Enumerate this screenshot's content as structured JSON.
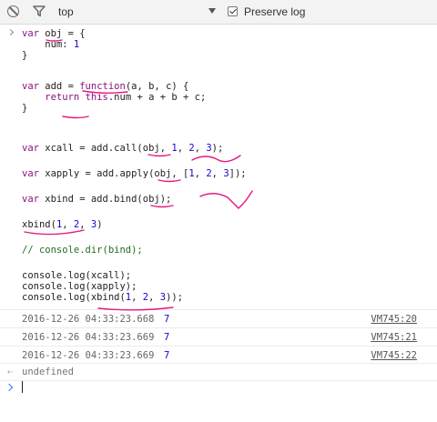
{
  "toolbar": {
    "context": "top",
    "preserve_log_label": "Preserve log",
    "preserve_log_checked": true
  },
  "code_lines": [
    {
      "id": "l1",
      "text": "var obj = {"
    },
    {
      "id": "l2",
      "text": "    num: 1"
    },
    {
      "id": "l3",
      "text": "}"
    },
    {
      "id": "l4",
      "text": ""
    },
    {
      "id": "l5",
      "text": "var add = function(a, b, c) {"
    },
    {
      "id": "l6",
      "text": "    return this.num + a + b + c;"
    },
    {
      "id": "l7",
      "text": "}"
    },
    {
      "id": "l8",
      "text": ""
    },
    {
      "id": "l9",
      "text": ""
    },
    {
      "id": "l10",
      "text": "var xcall = add.call(obj, 1, 2, 3);"
    },
    {
      "id": "l11",
      "text": ""
    },
    {
      "id": "l12",
      "text": "var xapply = add.apply(obj, [1, 2, 3]);"
    },
    {
      "id": "l13",
      "text": ""
    },
    {
      "id": "l14",
      "text": "var xbind = add.bind(obj);"
    },
    {
      "id": "l15",
      "text": ""
    },
    {
      "id": "l16",
      "text": "xbind(1, 2, 3)"
    },
    {
      "id": "l17",
      "text": ""
    },
    {
      "id": "l18",
      "text": "// console.dir(bind);"
    },
    {
      "id": "l19",
      "text": ""
    },
    {
      "id": "l20",
      "text": "console.log(xcall);"
    },
    {
      "id": "l21",
      "text": "console.log(xapply);"
    },
    {
      "id": "l22",
      "text": "console.log(xbind(1, 2, 3));"
    }
  ],
  "logs": [
    {
      "timestamp": "2016-12-26 04:33:23.668",
      "value": "7",
      "source": "VM745:20"
    },
    {
      "timestamp": "2016-12-26 04:33:23.669",
      "value": "7",
      "source": "VM745:21"
    },
    {
      "timestamp": "2016-12-26 04:33:23.669",
      "value": "7",
      "source": "VM745:22"
    }
  ],
  "result": {
    "text": "undefined"
  },
  "colors": {
    "keyword": "#881280",
    "number": "#1c00cf",
    "comment": "#236e25",
    "annotation": "#e8177f",
    "prompt": "#367cf1"
  }
}
